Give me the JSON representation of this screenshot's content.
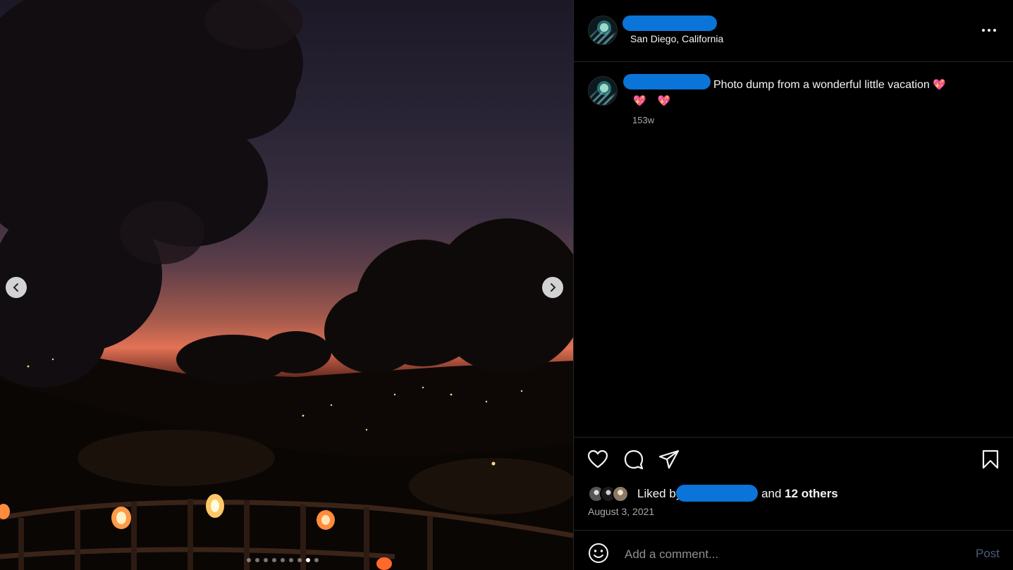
{
  "post": {
    "location": "San Diego, California",
    "caption": "Photo dump from a wonderful little vacation",
    "caption_emoji_inline": "💖",
    "caption_emoji_line2": "💖 💖",
    "caption_age": "153w",
    "date": "August 3, 2021"
  },
  "likes": {
    "prefix": "Liked by",
    "and": "and",
    "others": "12 others"
  },
  "comment": {
    "placeholder": "Add a comment...",
    "post_label": "Post"
  },
  "carousel": {
    "total_slides": 9,
    "active_slide": 8
  },
  "icons": {
    "more": "more-options-icon",
    "like": "heart-icon",
    "comment": "comment-icon",
    "share": "share-icon",
    "save": "bookmark-icon",
    "emoji": "emoji-icon",
    "prev": "chevron-left-icon",
    "next": "chevron-right-icon"
  },
  "colors": {
    "background": "#000000",
    "redaction": "#0b74d8",
    "post_button": "#4a5d78",
    "muted_text": "#a8a8a8"
  }
}
